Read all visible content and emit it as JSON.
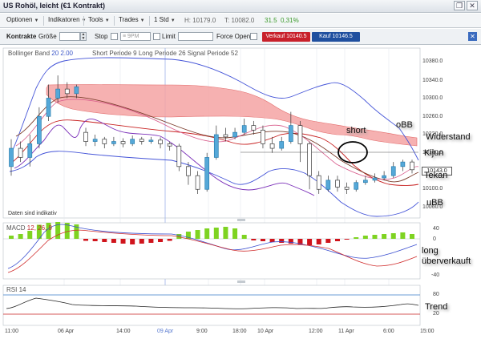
{
  "window": {
    "title": "US Rohöl, leicht (€1 Kontrakt)",
    "restore_icon": "restore-icon",
    "close_icon": "close-icon"
  },
  "menu": {
    "items": [
      "Optionen",
      "Indikatoren",
      "Tools",
      "Trades",
      "1 Std"
    ],
    "high": "H: 10179.0",
    "low": "T: 10082.0",
    "change": "31.5",
    "change_pct": "0,31%"
  },
  "orderbar": {
    "contracts_label": "Kontrakte",
    "size_label": "Größe",
    "size_value": "",
    "stop_label": "Stop",
    "stop_placeholder": "≡ 9PM",
    "limit_label": "Limit",
    "force_open_label": "Force Open",
    "sell_label": "Verkauf 10140.5",
    "buy_label": "Kauf 10146.5",
    "colors": {
      "sell": "#c8202a",
      "buy": "#1f4f9f"
    }
  },
  "main_panel": {
    "bb_label": "Bollinger Band",
    "bb_p1": "20",
    "bb_p2": "2.00",
    "ichimoku_text": "Short Periode  9    Long Periode  26   Signal Periode  52",
    "note": "Daten sind indikativ",
    "price_ticks": [
      "10380.0",
      "10340.0",
      "10300.0",
      "10260.0",
      "10220.0",
      "10180.0",
      "10100.0",
      "10060.0"
    ],
    "current_price": "10143.0"
  },
  "macd_panel": {
    "label": "MACD",
    "params": "12, 26, 9",
    "ticks": [
      "40",
      "0",
      "-40"
    ]
  },
  "rsi_panel": {
    "label": "RSI",
    "period": "14",
    "ticks": [
      "80",
      "20"
    ]
  },
  "time_axis": [
    "11:00",
    "06 Apr",
    "14:00",
    "09 Apr",
    "9:00",
    "18:00",
    "10 Apr",
    "12:00",
    "11 Apr",
    "6:00",
    "15:00"
  ],
  "annotations": {
    "short": "short",
    "obb": "oBB",
    "widerstand": "Widerstand",
    "kijun": "Kijun",
    "tekan": "Tekan",
    "ubb": "uBB",
    "long": "long",
    "ueberverkauft": "überverkauft",
    "trend": "Trend"
  },
  "chart_data": {
    "type": "candlestick",
    "price_axis_ticks": [
      10380,
      10340,
      10300,
      10260,
      10220,
      10180,
      10100,
      10060
    ],
    "candles": [
      {
        "o": 10150,
        "c": 10190,
        "h": 10210,
        "l": 10130
      },
      {
        "o": 10190,
        "c": 10170,
        "h": 10205,
        "l": 10160
      },
      {
        "o": 10170,
        "c": 10200,
        "h": 10220,
        "l": 10150
      },
      {
        "o": 10200,
        "c": 10260,
        "h": 10280,
        "l": 10190
      },
      {
        "o": 10260,
        "c": 10300,
        "h": 10330,
        "l": 10250
      },
      {
        "o": 10300,
        "c": 10320,
        "h": 10350,
        "l": 10290
      },
      {
        "o": 10320,
        "c": 10310,
        "h": 10335,
        "l": 10300
      },
      {
        "o": 10310,
        "c": 10325,
        "h": 10330,
        "l": 10300
      },
      {
        "o": 10225,
        "c": 10205,
        "h": 10235,
        "l": 10195
      },
      {
        "o": 10205,
        "c": 10210,
        "h": 10220,
        "l": 10195
      },
      {
        "o": 10210,
        "c": 10200,
        "h": 10215,
        "l": 10190
      },
      {
        "o": 10200,
        "c": 10205,
        "h": 10215,
        "l": 10195
      },
      {
        "o": 10205,
        "c": 10200,
        "h": 10212,
        "l": 10192
      },
      {
        "o": 10200,
        "c": 10210,
        "h": 10218,
        "l": 10195
      },
      {
        "o": 10210,
        "c": 10205,
        "h": 10215,
        "l": 10198
      },
      {
        "o": 10205,
        "c": 10208,
        "h": 10215,
        "l": 10200
      },
      {
        "o": 10208,
        "c": 10200,
        "h": 10214,
        "l": 10190
      },
      {
        "o": 10200,
        "c": 10195,
        "h": 10205,
        "l": 10185
      },
      {
        "o": 10195,
        "c": 10150,
        "h": 10200,
        "l": 10140
      },
      {
        "o": 10150,
        "c": 10130,
        "h": 10160,
        "l": 10110
      },
      {
        "o": 10130,
        "c": 10100,
        "h": 10140,
        "l": 10090
      },
      {
        "o": 10100,
        "c": 10170,
        "h": 10180,
        "l": 10095
      },
      {
        "o": 10170,
        "c": 10220,
        "h": 10240,
        "l": 10165
      },
      {
        "o": 10220,
        "c": 10215,
        "h": 10235,
        "l": 10205
      },
      {
        "o": 10215,
        "c": 10225,
        "h": 10235,
        "l": 10210
      },
      {
        "o": 10225,
        "c": 10240,
        "h": 10255,
        "l": 10220
      },
      {
        "o": 10240,
        "c": 10230,
        "h": 10250,
        "l": 10220
      },
      {
        "o": 10230,
        "c": 10200,
        "h": 10240,
        "l": 10190
      },
      {
        "o": 10200,
        "c": 10190,
        "h": 10215,
        "l": 10180
      },
      {
        "o": 10190,
        "c": 10205,
        "h": 10215,
        "l": 10185
      },
      {
        "o": 10205,
        "c": 10240,
        "h": 10270,
        "l": 10200
      },
      {
        "o": 10240,
        "c": 10200,
        "h": 10250,
        "l": 10160
      },
      {
        "o": 10200,
        "c": 10130,
        "h": 10205,
        "l": 10100
      },
      {
        "o": 10130,
        "c": 10100,
        "h": 10140,
        "l": 10090
      },
      {
        "o": 10100,
        "c": 10120,
        "h": 10130,
        "l": 10095
      },
      {
        "o": 10120,
        "c": 10105,
        "h": 10130,
        "l": 10095
      },
      {
        "o": 10105,
        "c": 10100,
        "h": 10115,
        "l": 10090
      },
      {
        "o": 10100,
        "c": 10115,
        "h": 10120,
        "l": 10095
      },
      {
        "o": 10115,
        "c": 10120,
        "h": 10130,
        "l": 10110
      },
      {
        "o": 10120,
        "c": 10125,
        "h": 10135,
        "l": 10115
      },
      {
        "o": 10125,
        "c": 10130,
        "h": 10140,
        "l": 10120
      },
      {
        "o": 10130,
        "c": 10150,
        "h": 10160,
        "l": 10125
      },
      {
        "o": 10150,
        "c": 10160,
        "h": 10165,
        "l": 10140
      },
      {
        "o": 10160,
        "c": 10143,
        "h": 10165,
        "l": 10135
      }
    ],
    "macd_histogram": [
      8,
      12,
      20,
      35,
      40,
      42,
      40,
      36,
      -5,
      -6,
      -8,
      -10,
      -12,
      -14,
      -12,
      -10,
      -8,
      -5,
      12,
      18,
      22,
      26,
      28,
      30,
      26,
      10,
      -4,
      -6,
      -8,
      -10,
      -12,
      -14,
      -16,
      -14,
      -10,
      -6,
      -2,
      4,
      8,
      10,
      12,
      14,
      16,
      12
    ],
    "rsi_levels": [
      80,
      20
    ]
  }
}
